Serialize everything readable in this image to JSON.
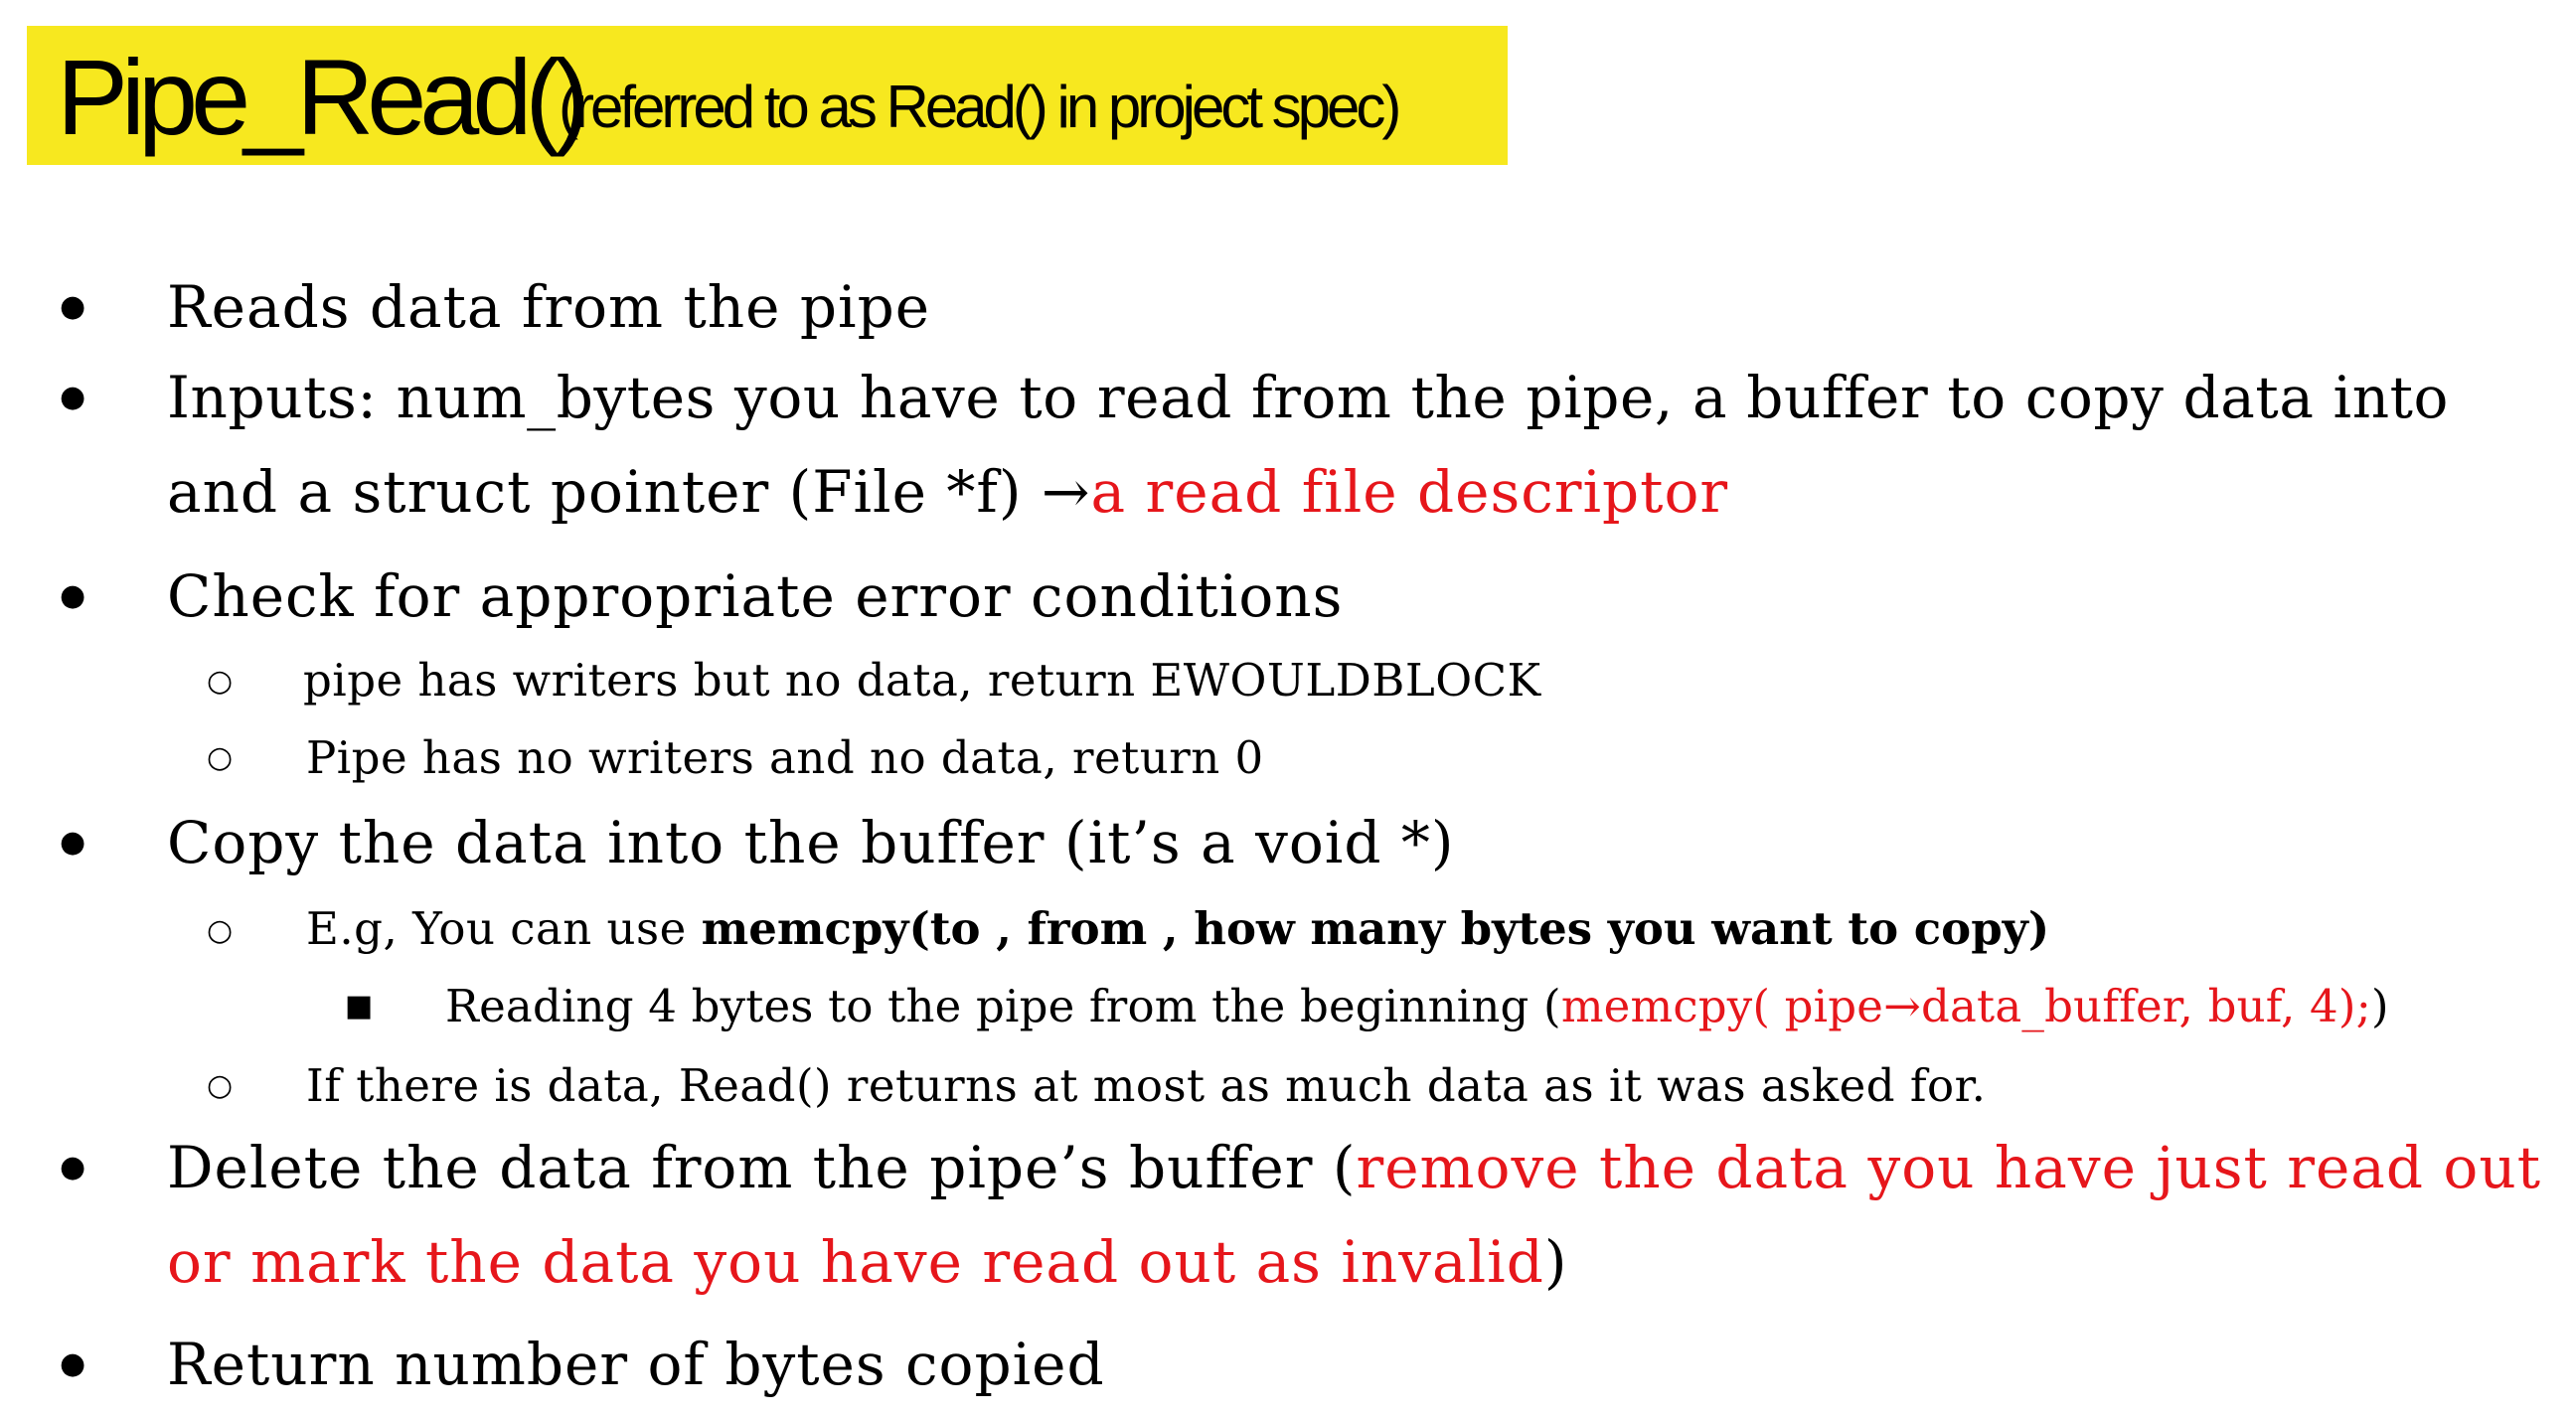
{
  "title": {
    "main": "Pipe_Read()",
    "subtitle": "(referred to as Read() in project spec)"
  },
  "bullets": {
    "b1": "Reads data from the pipe",
    "b2_line1": "Inputs:  num_bytes you have to read from the pipe, a buffer to copy data into",
    "b2_line2_black": "and a struct pointer (File *f) →",
    "b2_line2_red": "a read file descriptor",
    "b3": "Check for appropriate error conditions",
    "b3_sub1": " pipe has writers but no data, return EWOULDBLOCK",
    "b3_sub2": "Pipe has no writers and no data, return 0",
    "b4": "Copy the data into the buffer (it’s a void *)",
    "b4_sub1_normal": "E.g, You can use ",
    "b4_sub1_bold": "memcpy(to , from , how many bytes you want to copy)",
    "b4_sub1_sub1_normal": "Reading 4 bytes to the pipe from the beginning  (",
    "b4_sub1_sub1_red": "memcpy( pipe→data_buffer, buf,  4);",
    "b4_sub1_sub1_close": ")",
    "b4_sub2": "If there is data, Read() returns at most as much data as it was asked for.",
    "b5_line1_black": "Delete the data from the pipe’s buffer (",
    "b5_line1_red": "remove the data you have just read out",
    "b5_line2_red": "or mark the data you have read out as invalid",
    "b5_line2_close": ")",
    "b6": "Return number of bytes copied"
  },
  "markers": {
    "disc": "●",
    "circle": "○",
    "square": "■"
  },
  "colors": {
    "title_highlight": "#f7e81f",
    "accent_red": "#e6161b"
  }
}
